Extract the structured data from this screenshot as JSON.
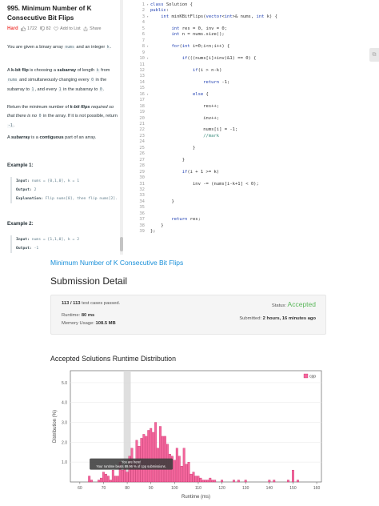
{
  "problem": {
    "title": "995. Minimum Number of K Consecutive Bit Flips",
    "difficulty": "Hard",
    "likes": "1722",
    "dislikes": "82",
    "add_to_list": "Add to List",
    "share": "Share",
    "desc_1": {
      "a": "You are given a binary array ",
      "b": "nums",
      "c": " and an integer ",
      "d": "k",
      "e": "."
    },
    "desc_2": {
      "a": "A ",
      "b": "k-bit flip",
      "c": " is choosing a ",
      "d": "subarray",
      "e": " of length ",
      "f": "k",
      "g": " from ",
      "h": "nums",
      "i": " and simultaneously changing every ",
      "j": "0",
      "k": " in the subarray to ",
      "l": "1",
      "m": ", and every ",
      "n": "1",
      "o": " in the subarray to ",
      "p": "0",
      "q": "."
    },
    "desc_3": {
      "a": "Return the minimum number of ",
      "b": "k-bit flips",
      "c": " required so that there is no ",
      "d": "0",
      "e": " in the array. If it is not possible, return ",
      "f": "-1",
      "g": "."
    },
    "desc_4": {
      "a": "A ",
      "b": "subarray",
      "c": " is a ",
      "d": "contiguous",
      "e": " part of an array."
    },
    "examples": [
      {
        "title": "Example 1:",
        "input_label": "Input:",
        "input": " nums = [0,1,0], k = 1",
        "output_label": "Output:",
        "output": " 2",
        "explanation_label": "Explanation:",
        "explanation": " Flip nums[0], then flip nums[2]."
      },
      {
        "title": "Example 2:",
        "input_label": "Input:",
        "input": " nums = [1,1,0], k = 2",
        "output_label": "Output:",
        "output": " -1"
      }
    ]
  },
  "code": {
    "lines": [
      "class Solution {",
      "public:",
      "    int minKBitFlips(vector<int>& nums, int k) {",
      "",
      "        int res = 0, inv = 0;",
      "        int n = nums.size();",
      "",
      "        for(int i=0;i<n;i++) {",
      "",
      "            if(((nums[i]+inv)&1) == 0) {",
      "",
      "                if(i > n-k)",
      "",
      "                    return -1;",
      "",
      "                else {",
      "",
      "                    res++;",
      "",
      "                    inv++;",
      "",
      "                    nums[i] = -1;",
      "                    //mark",
      "",
      "                }",
      "",
      "            }",
      "",
      "            if(i + 1 >= k)",
      "",
      "                inv -= (nums[i-k+1] < 0);",
      "",
      "",
      "        }",
      "",
      "",
      "        return res;",
      "    }",
      "};"
    ],
    "folded_lines": [
      1,
      3,
      8,
      10,
      16
    ]
  },
  "submission": {
    "problem_link": "Minimum Number of K Consecutive Bit Flips",
    "heading": "Submission Detail",
    "tests_count": "113 / 113",
    "tests_label": " test cases passed.",
    "status_label": "Status: ",
    "status_value": "Accepted",
    "runtime_label": "Runtime: ",
    "runtime_value": "80 ms",
    "memory_label": "Memory Usage: ",
    "memory_value": "108.5 MB",
    "submitted_label": "Submitted: ",
    "submitted_value": "2 hours, 16 minutes ago",
    "accent_color": "#5cb85c",
    "link_color": "#1a90d9"
  },
  "chart_data": {
    "type": "bar",
    "title": "Accepted Solutions Runtime Distribution",
    "xlabel": "Runtime (ms)",
    "ylabel": "Distribution (%)",
    "xlim": [
      56,
      162
    ],
    "ylim": [
      0,
      5.6
    ],
    "x_ticks": [
      60,
      70,
      80,
      90,
      100,
      110,
      120,
      130,
      140,
      150,
      160
    ],
    "y_ticks": [
      1.0,
      2.0,
      3.0,
      4.0,
      5.0
    ],
    "legend": [
      "cpp"
    ],
    "legend_position": "top-right",
    "bar_color": "#f4679d",
    "bar_edge_color": "#c2185b",
    "highlight_x": 80,
    "tooltip_title": "You are here!",
    "tooltip_text": "Your runtime beats 89.96 % of cpp submissions.",
    "grid": true,
    "x": [
      60,
      61,
      62,
      63,
      64,
      65,
      66,
      67,
      68,
      69,
      70,
      71,
      72,
      73,
      74,
      75,
      76,
      77,
      78,
      79,
      80,
      81,
      82,
      83,
      84,
      85,
      86,
      87,
      88,
      89,
      90,
      91,
      92,
      93,
      94,
      95,
      96,
      97,
      98,
      99,
      100,
      101,
      102,
      103,
      104,
      105,
      106,
      107,
      108,
      109,
      110,
      111,
      112,
      113,
      114,
      115,
      116,
      117,
      118,
      119,
      120,
      121,
      122,
      123,
      124,
      125,
      126,
      127,
      128,
      129,
      130,
      131,
      132,
      133,
      134,
      135,
      136,
      137,
      138,
      139,
      140,
      141,
      142,
      143,
      144,
      145,
      146,
      147,
      148,
      149,
      150,
      151,
      152,
      153,
      154,
      155,
      156,
      157,
      158,
      159,
      160
    ],
    "values": [
      0,
      0,
      0,
      0,
      0.3,
      0.1,
      0,
      0,
      0.1,
      0.2,
      0.5,
      0.4,
      0.3,
      0.1,
      0.6,
      0.3,
      0.3,
      1.0,
      0.6,
      0.7,
      0.5,
      1.3,
      1.7,
      1.1,
      2.1,
      1.8,
      2.2,
      2.4,
      2.3,
      2.6,
      2.7,
      2.5,
      3.0,
      1.7,
      2.8,
      2.3,
      2.3,
      1.9,
      1.4,
      1.3,
      1.1,
      1.7,
      1.3,
      0.8,
      1.7,
      0.9,
      1.0,
      0.4,
      0.5,
      0.3,
      0.3,
      0.2,
      0.1,
      0.1,
      0.1,
      0.2,
      0.1,
      0.1,
      0,
      0,
      0.1,
      0,
      0,
      0,
      0,
      0.1,
      0,
      0.1,
      0,
      0,
      0.1,
      0,
      0,
      0,
      0,
      0,
      0,
      0,
      0,
      0,
      0.1,
      0,
      0.1,
      0,
      0,
      0,
      0,
      0,
      0.1,
      0,
      0.6,
      0,
      0.1,
      0,
      0,
      0,
      0,
      0,
      0,
      0,
      0
    ]
  }
}
